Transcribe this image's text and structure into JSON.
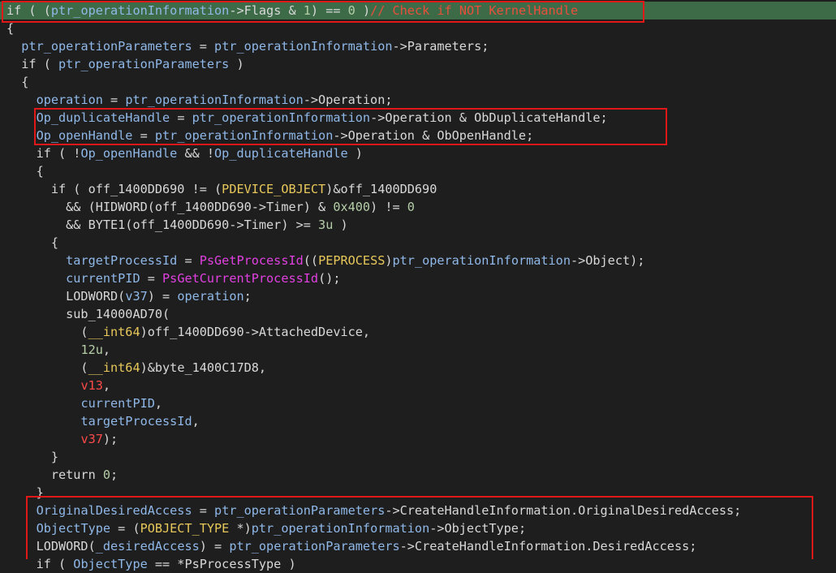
{
  "editor": {
    "lines": [
      [
        {
          "t": "if ( ("
        },
        {
          "t": "ptr_operationInformation",
          "c": "var"
        },
        {
          "t": "->Flags & "
        },
        {
          "t": "1",
          "c": "num"
        },
        {
          "t": ") == "
        },
        {
          "t": "0",
          "c": "num"
        },
        {
          "t": " )"
        },
        {
          "t": "// Check if NOT KernelHandle",
          "c": "cmt"
        }
      ],
      [
        {
          "t": "{"
        }
      ],
      [
        {
          "t": "  "
        },
        {
          "t": "ptr_operationParameters",
          "c": "var"
        },
        {
          "t": " = "
        },
        {
          "t": "ptr_operationInformation",
          "c": "var"
        },
        {
          "t": "->Parameters;"
        }
      ],
      [
        {
          "t": "  if ( "
        },
        {
          "t": "ptr_operationParameters",
          "c": "var"
        },
        {
          "t": " )"
        }
      ],
      [
        {
          "t": "  {"
        }
      ],
      [
        {
          "t": "    "
        },
        {
          "t": "operation",
          "c": "var"
        },
        {
          "t": " = "
        },
        {
          "t": "ptr_operationInformation",
          "c": "var"
        },
        {
          "t": "->Operation;"
        }
      ],
      [
        {
          "t": "    "
        },
        {
          "t": "Op_duplicateHandle",
          "c": "var"
        },
        {
          "t": " = "
        },
        {
          "t": "ptr_operationInformation",
          "c": "var"
        },
        {
          "t": "->Operation & ObDuplicateHandle;"
        }
      ],
      [
        {
          "t": "    "
        },
        {
          "t": "Op_openHandle",
          "c": "var"
        },
        {
          "t": " = "
        },
        {
          "t": "ptr_operationInformation",
          "c": "var"
        },
        {
          "t": "->Operation & ObOpenHandle;"
        }
      ],
      [
        {
          "t": "    if ( !"
        },
        {
          "t": "Op_openHandle",
          "c": "var"
        },
        {
          "t": " && !"
        },
        {
          "t": "Op_duplicateHandle",
          "c": "var"
        },
        {
          "t": " )"
        }
      ],
      [
        {
          "t": "    {"
        }
      ],
      [
        {
          "t": "      if ( off_1400DD690 != ("
        },
        {
          "t": "PDEVICE_OBJECT",
          "c": "kw"
        },
        {
          "t": ")&off_1400DD690"
        }
      ],
      [
        {
          "t": "        && (HIDWORD(off_1400DD690->Timer) & "
        },
        {
          "t": "0x400",
          "c": "num"
        },
        {
          "t": ") != "
        },
        {
          "t": "0",
          "c": "num"
        }
      ],
      [
        {
          "t": "        && BYTE1(off_1400DD690->Timer) >= "
        },
        {
          "t": "3u",
          "c": "num"
        },
        {
          "t": " )"
        }
      ],
      [
        {
          "t": "      {"
        }
      ],
      [
        {
          "t": "        "
        },
        {
          "t": "targetProcessId",
          "c": "var"
        },
        {
          "t": " = "
        },
        {
          "t": "PsGetProcessId",
          "c": "fn"
        },
        {
          "t": "(("
        },
        {
          "t": "PEPROCESS",
          "c": "kw"
        },
        {
          "t": ")"
        },
        {
          "t": "ptr_operationInformation",
          "c": "var"
        },
        {
          "t": "->Object);"
        }
      ],
      [
        {
          "t": "        "
        },
        {
          "t": "currentPID",
          "c": "var"
        },
        {
          "t": " = "
        },
        {
          "t": "PsGetCurrentProcessId",
          "c": "fn"
        },
        {
          "t": "();"
        }
      ],
      [
        {
          "t": "        LODWORD("
        },
        {
          "t": "v37",
          "c": "var"
        },
        {
          "t": ") = "
        },
        {
          "t": "operation",
          "c": "var"
        },
        {
          "t": ";"
        }
      ],
      [
        {
          "t": "        sub_14000AD70("
        }
      ],
      [
        {
          "t": "          ("
        },
        {
          "t": "__int64",
          "c": "kw"
        },
        {
          "t": ")off_1400DD690->AttachedDevice,"
        }
      ],
      [
        {
          "t": "          "
        },
        {
          "t": "12u",
          "c": "num"
        },
        {
          "t": ","
        }
      ],
      [
        {
          "t": "          ("
        },
        {
          "t": "__int64",
          "c": "kw"
        },
        {
          "t": ")&byte_1400C17D8,"
        }
      ],
      [
        {
          "t": "          "
        },
        {
          "t": "v13",
          "c": "lv"
        },
        {
          "t": ","
        }
      ],
      [
        {
          "t": "          "
        },
        {
          "t": "currentPID",
          "c": "var"
        },
        {
          "t": ","
        }
      ],
      [
        {
          "t": "          "
        },
        {
          "t": "targetProcessId",
          "c": "var"
        },
        {
          "t": ","
        }
      ],
      [
        {
          "t": "          "
        },
        {
          "t": "v37",
          "c": "lv"
        },
        {
          "t": ");"
        }
      ],
      [
        {
          "t": "      }"
        }
      ],
      [
        {
          "t": "      return "
        },
        {
          "t": "0",
          "c": "num"
        },
        {
          "t": ";"
        }
      ],
      [
        {
          "t": "    }"
        }
      ],
      [
        {
          "t": "    "
        },
        {
          "t": "OriginalDesiredAccess",
          "c": "var"
        },
        {
          "t": " = "
        },
        {
          "t": "ptr_operationParameters",
          "c": "var"
        },
        {
          "t": "->CreateHandleInformation.OriginalDesiredAccess;"
        }
      ],
      [
        {
          "t": "    "
        },
        {
          "t": "ObjectType",
          "c": "var"
        },
        {
          "t": " = ("
        },
        {
          "t": "POBJECT_TYPE",
          "c": "kw"
        },
        {
          "t": " *)"
        },
        {
          "t": "ptr_operationInformation",
          "c": "var"
        },
        {
          "t": "->ObjectType;"
        }
      ],
      [
        {
          "t": "    LODWORD("
        },
        {
          "t": "_desiredAccess",
          "c": "var"
        },
        {
          "t": ") = "
        },
        {
          "t": "ptr_operationParameters",
          "c": "var"
        },
        {
          "t": "->CreateHandleInformation.DesiredAccess;"
        }
      ],
      [
        {
          "t": "    if ( "
        },
        {
          "t": "ObjectType",
          "c": "var"
        },
        {
          "t": " == *PsProcessType )"
        }
      ]
    ]
  },
  "colors": {
    "background": "#1e1e1e",
    "current_line": "#3d6b48",
    "highlight_box": "#e01818",
    "variable": "#8fb8e8",
    "comment": "#e8503a",
    "function": "#e040e0",
    "type_cast": "#e8c85a",
    "local_var": "#ff4a4a"
  }
}
